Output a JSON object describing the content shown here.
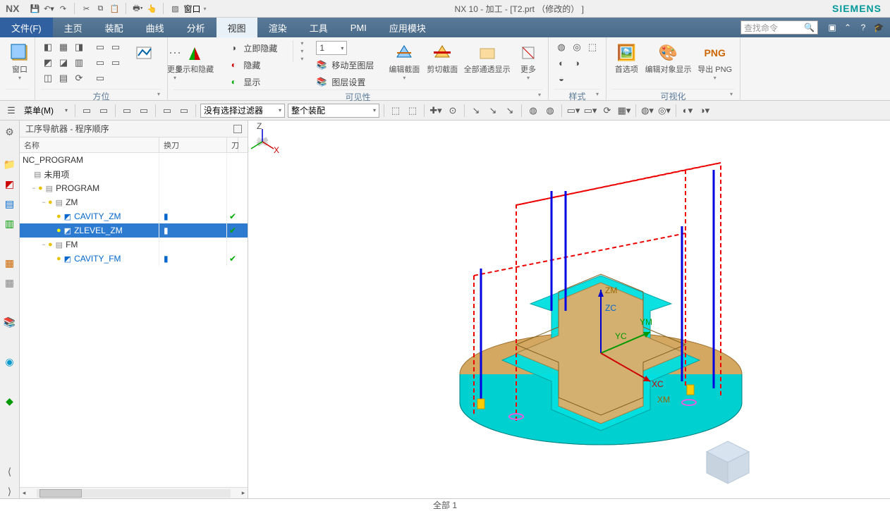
{
  "app": {
    "logo": "NX",
    "brand": "SIEMENS",
    "title": "NX 10 - 加工 - [T2.prt （修改的） ]"
  },
  "qat": {
    "window_label": "窗口"
  },
  "tabs": {
    "file": "文件(F)",
    "home": "主页",
    "assembly": "装配",
    "curve": "曲线",
    "analysis": "分析",
    "view": "视图",
    "render": "渲染",
    "tool": "工具",
    "pmi": "PMI",
    "app": "应用模块"
  },
  "search": {
    "placeholder": "查找命令"
  },
  "ribbon": {
    "window": {
      "label": "窗口",
      "group": ""
    },
    "orient": {
      "more": "更多",
      "group": "方位"
    },
    "showhide": {
      "label": "显示和隐藏",
      "immediate_hide": "立即隐藏",
      "hide": "隐藏",
      "show": "显示",
      "move_layer": "移动至图层",
      "layer_setting": "图层设置",
      "layer_num": "1",
      "more": "更多",
      "group": "可见性"
    },
    "section": {
      "edit": "编辑截面",
      "clip": "剪切截面",
      "alltrans": "全部通透显示",
      "more": "更多"
    },
    "style": {
      "group": "样式"
    },
    "visualize": {
      "pref": "首选项",
      "editobj": "编辑对象显示",
      "exportpng": "导出 PNG",
      "png": "PNG",
      "group": "可视化"
    }
  },
  "toolrow": {
    "menu": "菜单(M)",
    "filter": "没有选择过滤器",
    "assembly": "整个装配"
  },
  "nav": {
    "title": "工序导航器 - 程序顺序",
    "cols": {
      "name": "名称",
      "tool": "换刀",
      "c3": "刀"
    },
    "root": "NC_PROGRAM",
    "unused": "未用项",
    "program": "PROGRAM",
    "zm": "ZM",
    "cavity_zm": "CAVITY_ZM",
    "zlevel_zm": "ZLEVEL_ZM",
    "fm": "FM",
    "cavity_fm": "CAVITY_FM"
  },
  "axes": {
    "zm": "ZM",
    "zc": "ZC",
    "ym": "YM",
    "yc": "YC",
    "xc": "XC",
    "xm": "XM"
  },
  "status": {
    "text": "全部 1"
  }
}
